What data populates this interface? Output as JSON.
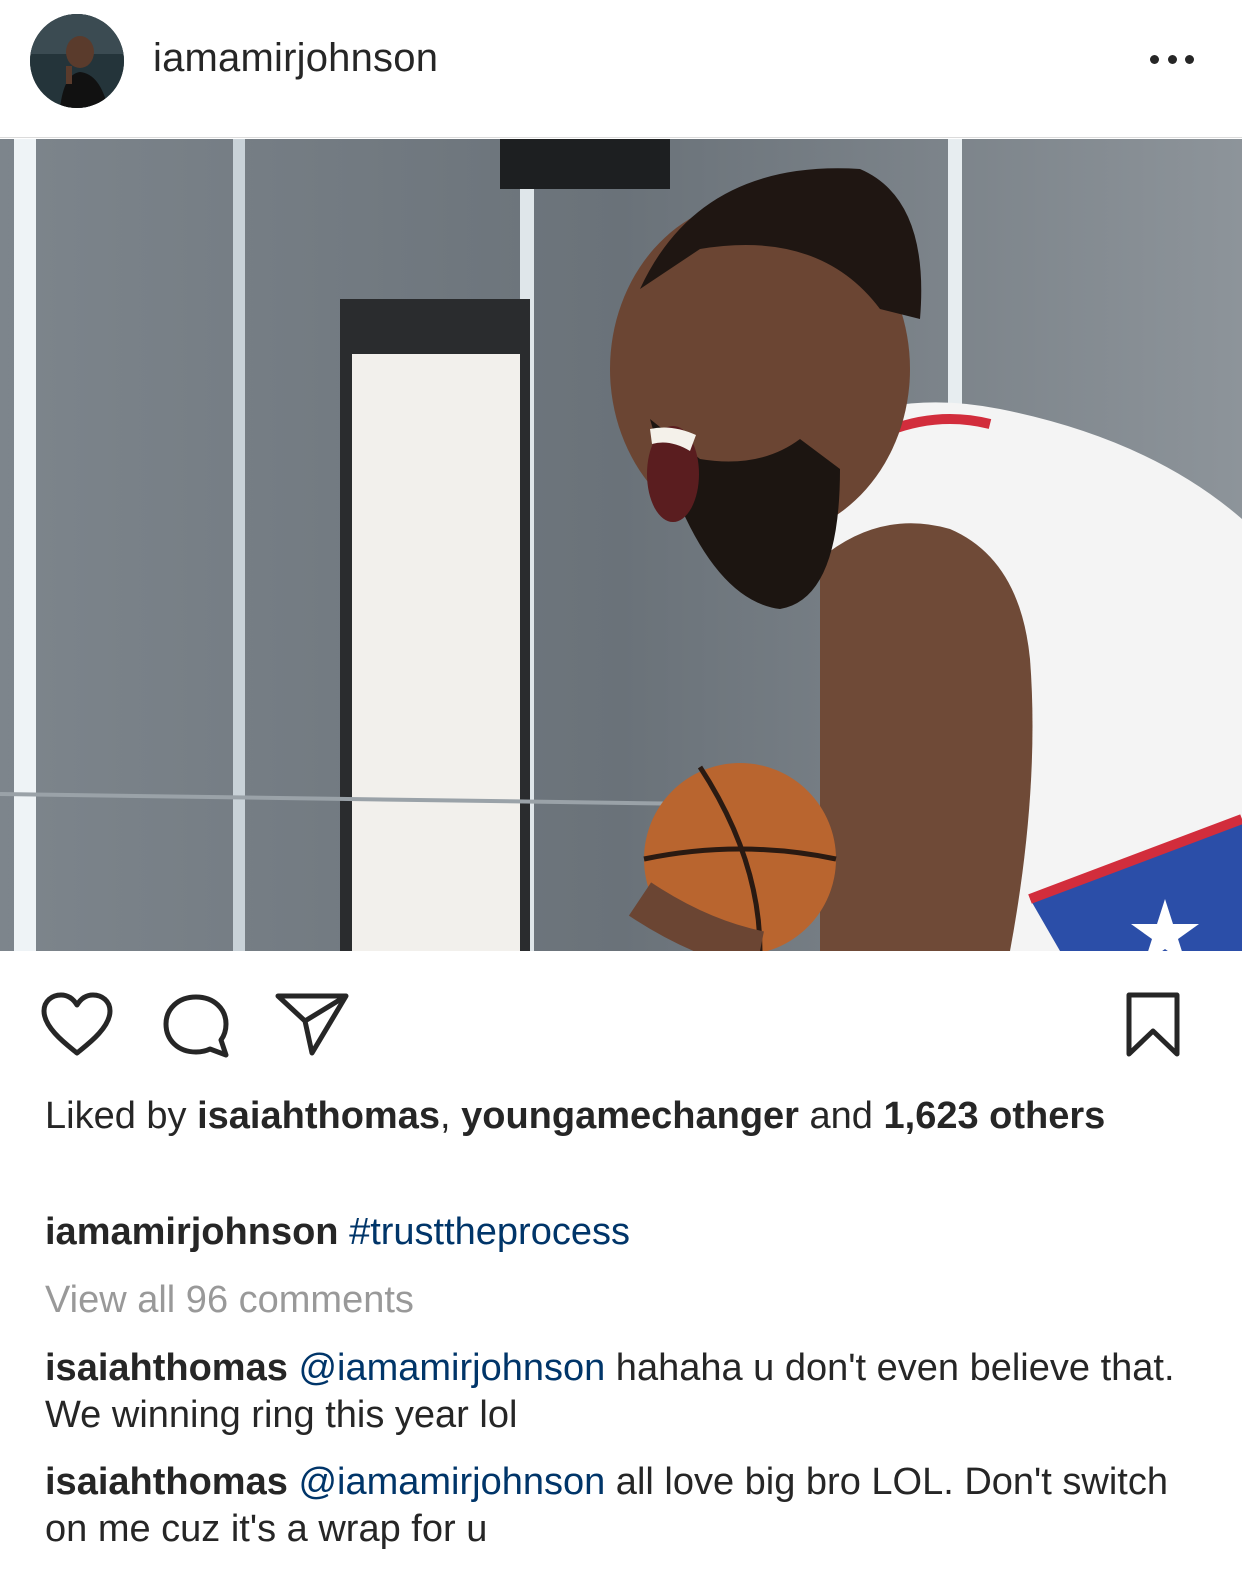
{
  "post": {
    "username": "iamamirjohnson",
    "more_icon": "more-horizontal-icon"
  },
  "photo": {
    "subject": "basketball-player-photo"
  },
  "actions": {
    "like_icon": "heart-icon",
    "comment_icon": "comment-icon",
    "share_icon": "paper-plane-icon",
    "save_icon": "bookmark-icon"
  },
  "likes": {
    "prefix": "Liked by ",
    "user1": "isaiahthomas",
    "sep": ", ",
    "user2": "youngamechanger",
    "and": " and ",
    "count": "1,623",
    "others": " others"
  },
  "caption": {
    "username": "iamamirjohnson",
    "hashtag": "#trusttheprocess"
  },
  "view_all_comments": "View all 96 comments",
  "comments": [
    {
      "username": "isaiahthomas",
      "mention": "@iamamirjohnson",
      "text": " hahaha u don't even believe that. We winning ring this year lol"
    },
    {
      "username": "isaiahthomas",
      "mention": "@iamamirjohnson",
      "text": " all love big bro LOL. Don't switch on me cuz it's a wrap for u"
    }
  ],
  "colors": {
    "text": "#262626",
    "link": "#003569",
    "muted": "#999999",
    "divider": "#dbdbdb"
  }
}
